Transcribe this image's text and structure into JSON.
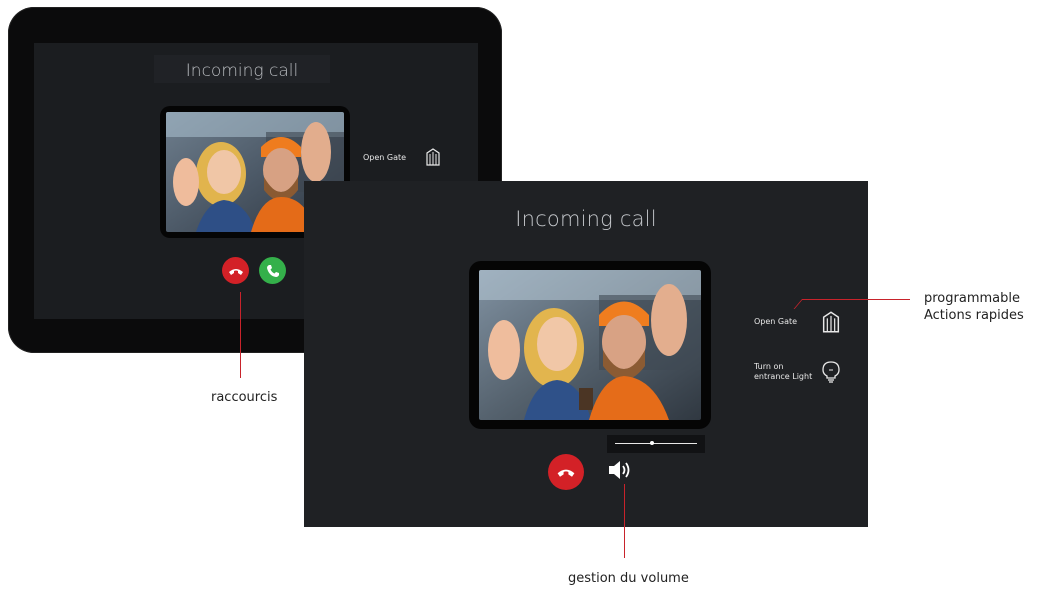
{
  "back_device": {
    "title": "Incoming call",
    "actions": [
      {
        "label": "Open Gate",
        "icon": "gate-icon"
      }
    ]
  },
  "front_device": {
    "title": "Incoming call",
    "actions": [
      {
        "label": "Open Gate",
        "icon": "gate-icon"
      },
      {
        "label": "Turn on entrance Light",
        "icon": "lightbulb-icon"
      }
    ],
    "volume_level": 0.45
  },
  "annotations": {
    "shortcuts": "raccourcis",
    "programmable_line1": "programmable",
    "programmable_line2": "Actions rapides",
    "volume": "gestion du volume"
  },
  "colors": {
    "hangup": "#d32127",
    "answer": "#34b04a",
    "annotation_line": "#c8232b"
  }
}
